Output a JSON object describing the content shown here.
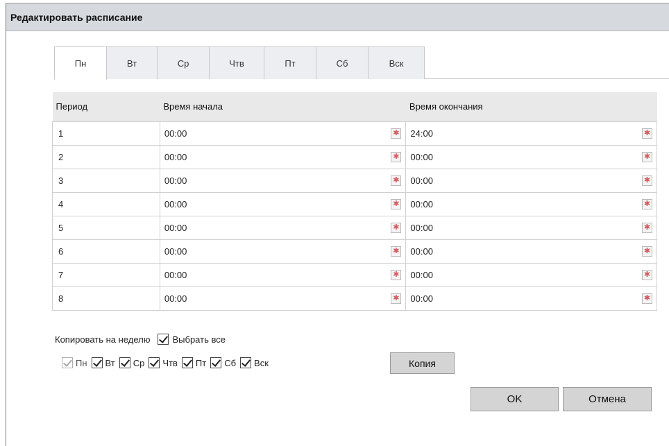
{
  "dialog": {
    "title": "Редактировать расписание"
  },
  "tabs": [
    {
      "label": "Пн",
      "active": true
    },
    {
      "label": "Вт",
      "active": false
    },
    {
      "label": "Ср",
      "active": false
    },
    {
      "label": "Чтв",
      "active": false
    },
    {
      "label": "Пт",
      "active": false
    },
    {
      "label": "Сб",
      "active": false
    },
    {
      "label": "Вск",
      "active": false
    }
  ],
  "table": {
    "headers": {
      "period": "Период",
      "start": "Время начала",
      "end": "Время окончания"
    },
    "rows": [
      {
        "period": "1",
        "start": "00:00",
        "end": "24:00"
      },
      {
        "period": "2",
        "start": "00:00",
        "end": "00:00"
      },
      {
        "period": "3",
        "start": "00:00",
        "end": "00:00"
      },
      {
        "period": "4",
        "start": "00:00",
        "end": "00:00"
      },
      {
        "period": "5",
        "start": "00:00",
        "end": "00:00"
      },
      {
        "period": "6",
        "start": "00:00",
        "end": "00:00"
      },
      {
        "period": "7",
        "start": "00:00",
        "end": "00:00"
      },
      {
        "period": "8",
        "start": "00:00",
        "end": "00:00"
      }
    ],
    "picker_icon": "calendar-clock-icon"
  },
  "copy": {
    "label": "Копировать на неделю",
    "select_all_label": "Выбрать все",
    "select_all_checked": true,
    "days": [
      {
        "label": "Пн",
        "checked": true,
        "disabled": true
      },
      {
        "label": "Вт",
        "checked": true,
        "disabled": false
      },
      {
        "label": "Ср",
        "checked": true,
        "disabled": false
      },
      {
        "label": "Чтв",
        "checked": true,
        "disabled": false
      },
      {
        "label": "Пт",
        "checked": true,
        "disabled": false
      },
      {
        "label": "Сб",
        "checked": true,
        "disabled": false
      },
      {
        "label": "Вск",
        "checked": true,
        "disabled": false
      }
    ],
    "copy_button": "Копия"
  },
  "footer": {
    "ok_label": "OK",
    "cancel_label": "Отмена"
  }
}
